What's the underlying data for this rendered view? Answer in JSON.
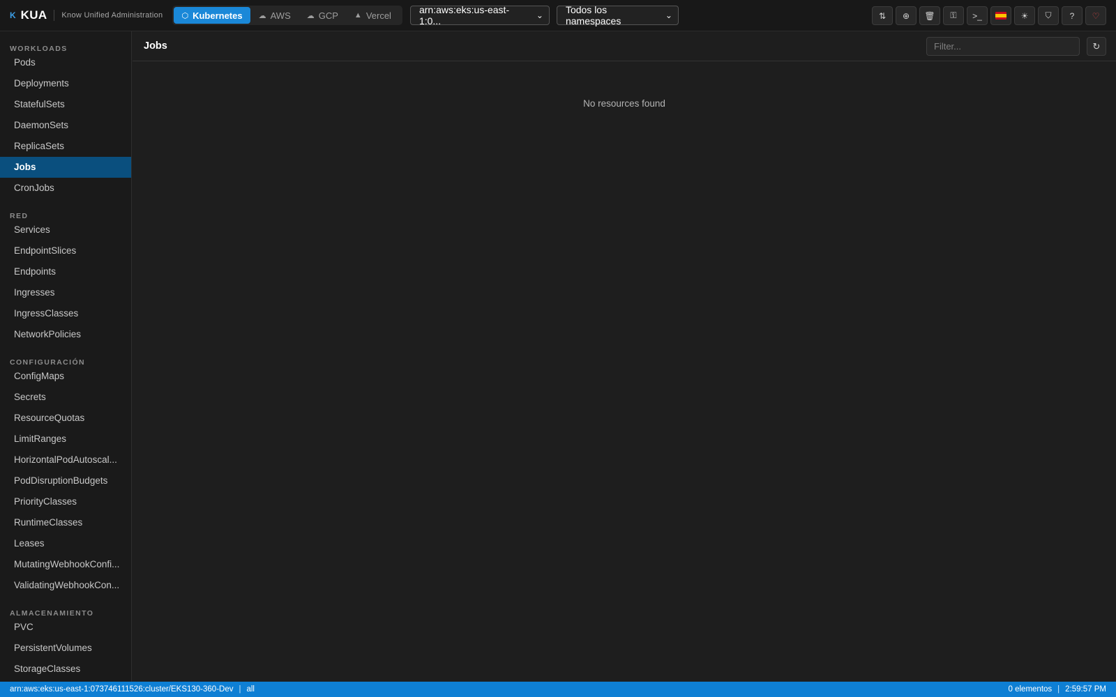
{
  "brand": {
    "mark": "K",
    "name": "KUA",
    "subtitle": "Know Unified Administration"
  },
  "providers": [
    {
      "label": "Kubernetes",
      "icon": "cube-icon",
      "glyph": "⬡",
      "active": true
    },
    {
      "label": "AWS",
      "icon": "cloud-icon",
      "glyph": "☁",
      "active": false
    },
    {
      "label": "GCP",
      "icon": "cloud-upload-icon",
      "glyph": "☁",
      "active": false
    },
    {
      "label": "Vercel",
      "icon": "triangle-icon",
      "glyph": "▲",
      "active": false
    }
  ],
  "context_select": {
    "value": "arn:aws:eks:us-east-1:0..."
  },
  "namespace_select": {
    "value": "Todos los namespaces"
  },
  "toolbar": {
    "icons": [
      "port-forward-icon",
      "plus-circle-icon",
      "trash-icon",
      "key-icon",
      "terminal-icon",
      "spain-flag-icon",
      "sun-icon",
      "shield-icon",
      "help-icon",
      "heart-icon"
    ],
    "glyphs": [
      "⇅",
      "⊕",
      "🗑",
      "⚿",
      ">_",
      "",
      "☀",
      "⛉",
      "?",
      "♡"
    ]
  },
  "sidebar": {
    "sections": [
      {
        "title": "WORKLOADS",
        "items": [
          "Pods",
          "Deployments",
          "StatefulSets",
          "DaemonSets",
          "ReplicaSets",
          "Jobs",
          "CronJobs"
        ]
      },
      {
        "title": "RED",
        "items": [
          "Services",
          "EndpointSlices",
          "Endpoints",
          "Ingresses",
          "IngressClasses",
          "NetworkPolicies"
        ]
      },
      {
        "title": "CONFIGURACIÓN",
        "items": [
          "ConfigMaps",
          "Secrets",
          "ResourceQuotas",
          "LimitRanges",
          "HorizontalPodAutoscal...",
          "PodDisruptionBudgets",
          "PriorityClasses",
          "RuntimeClasses",
          "Leases",
          "MutatingWebhookConfi...",
          "ValidatingWebhookCon..."
        ]
      },
      {
        "title": "ALMACENAMIENTO",
        "items": [
          "PVC",
          "PersistentVolumes",
          "StorageClasses"
        ]
      }
    ],
    "active_item": "Jobs"
  },
  "main": {
    "title": "Jobs",
    "filter_placeholder": "Filter...",
    "empty_message": "No resources found"
  },
  "status": {
    "cluster": "arn:aws:eks:us-east-1:073746111526:cluster/EKS130-360-Dev",
    "namespace": "all",
    "count": "0 elementos",
    "time": "2:59:57 PM"
  },
  "colors": {
    "accent": "#1a88d8",
    "active_nav": "#0a4f7e",
    "statusbar": "#0e7fd4",
    "heart": "#e54848"
  }
}
